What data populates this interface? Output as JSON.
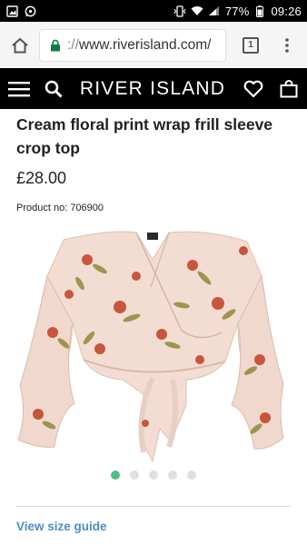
{
  "status_bar": {
    "battery": "77%",
    "time": "09:26",
    "icons": [
      "gallery-icon",
      "whatsapp-icon",
      "vibrate-icon",
      "wifi-icon",
      "signal-icon",
      "battery-icon"
    ]
  },
  "browser": {
    "url_scheme": "://",
    "url_host": "www.riverisland.com/",
    "tab_count": "1"
  },
  "site": {
    "brand": "RIVER ISLAND"
  },
  "product": {
    "title": "Cream floral print wrap frill sleeve crop top",
    "price": "£28.00",
    "product_no": "Product no: 706900",
    "image_count": 5,
    "active_image": 1
  },
  "links": {
    "size_guide": "View size guide"
  },
  "colors": {
    "header_bg": "#000000",
    "link": "#4a8ec8",
    "active_dot": "#4fbf8a",
    "garment": "#f3ddd3"
  }
}
